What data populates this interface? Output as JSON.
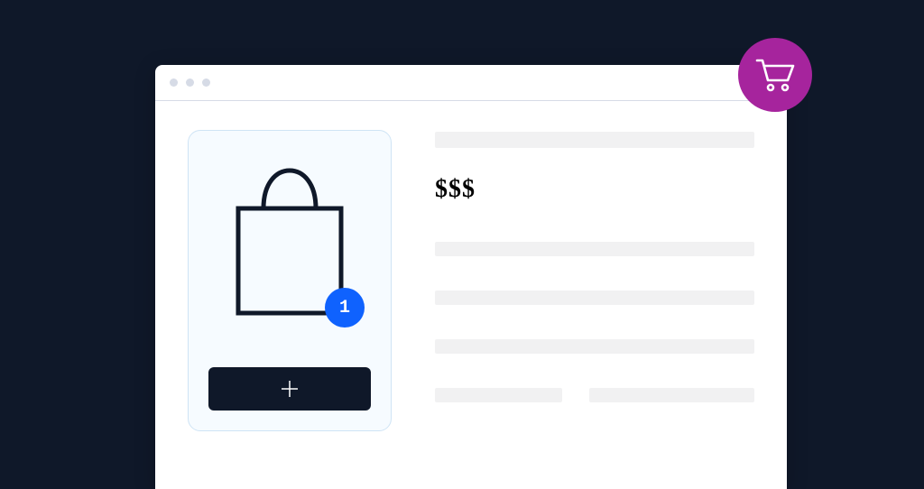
{
  "product": {
    "quantity_badge": "1",
    "price_label": "$$$"
  },
  "colors": {
    "page_bg": "#0f1829",
    "accent_blue": "#0f62fe",
    "cart_purple": "#a6249d",
    "card_bg": "#f6fbff",
    "card_border": "#cfe4f5",
    "skeleton": "#f1f1f2"
  },
  "icons": {
    "shopping_bag": "shopping-bag-icon",
    "plus": "plus-icon",
    "cart": "shopping-cart-icon"
  }
}
